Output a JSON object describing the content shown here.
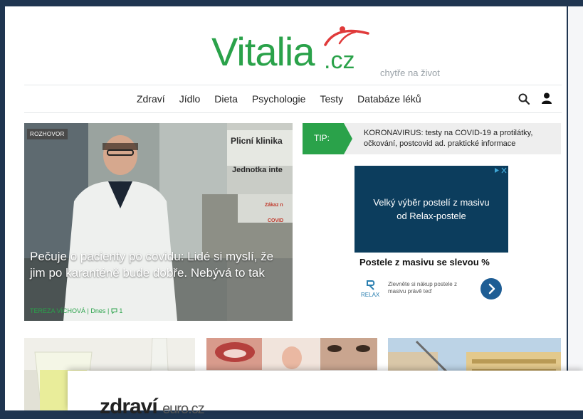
{
  "logo": {
    "word": "Vitalia",
    "domain": ".cz",
    "tagline": "chytře na život",
    "brand_color": "#2aa24a",
    "accent_color": "#e03a3a"
  },
  "nav": {
    "items": [
      "Zdraví",
      "Jídlo",
      "Dieta",
      "Psychologie",
      "Testy",
      "Databáze léků"
    ],
    "search_icon": "search-icon",
    "user_icon": "user-icon"
  },
  "hero": {
    "badge": "ROZHOVOR",
    "title": "Pečuje o pacienty po covidu: Lidé si myslí, že jim po karanténě bude dobře. Nebývá to tak",
    "author": "TEREZA VÍCHOVÁ",
    "date": "Dnes",
    "comments": "1",
    "sign_1": "Plicní klinika",
    "sign_2": "Jednotka inte",
    "sign_3": "Zákaz n",
    "sign_4": "COVID"
  },
  "tip": {
    "label": "TIP:",
    "text": "KORONAVIRUS: testy na COVID-19 a protilátky, očkování, postcovid ad. praktické informace"
  },
  "ad": {
    "box_text": "Velký výběr postelí z masivu od Relax-postele",
    "headline": "Postele z masivu se slevou %",
    "brand": "RELAX",
    "description": "Zlevněte si nákup postele z masivu právě teď"
  },
  "popup": {
    "logo": "zdraví",
    "logo_sub": "euro.cz"
  },
  "colors": {
    "frame_bg": "#1f3550",
    "ad_bg": "#0c3d5d",
    "tip_green": "#2aa24a"
  }
}
